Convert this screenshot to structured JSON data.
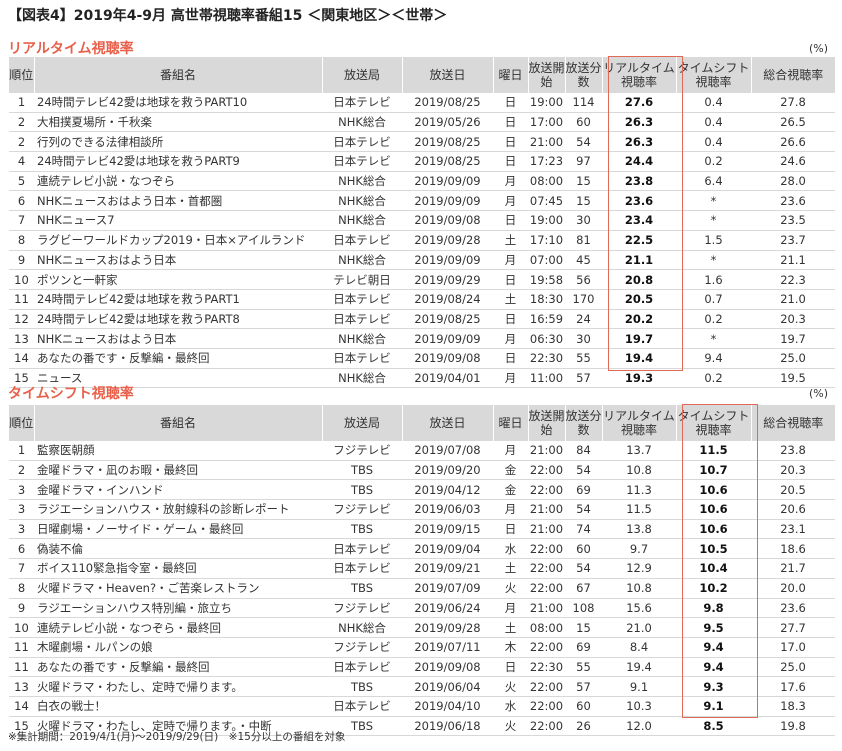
{
  "title": "【図表4】2019年4-9月 高世帯視聴率番組15 ＜関東地区＞＜世帯＞",
  "unit": "(%)",
  "headers": {
    "rank": "順位",
    "program": "番組名",
    "station": "放送局",
    "date": "放送日",
    "day": "曜日",
    "start": "放送開始",
    "minutes": "放送分数",
    "realtime": "リアルタイム視聴率",
    "timeshift": "タイムシフト視聴率",
    "total": "総合視聴率"
  },
  "realtime_section": {
    "title": "リアルタイム視聴率",
    "rows": [
      {
        "rank": "1",
        "program": "24時間テレビ42愛は地球を救うPART10",
        "station": "日本テレビ",
        "date": "2019/08/25",
        "day": "日",
        "start": "19:00",
        "minutes": "114",
        "realtime": "27.6",
        "timeshift": "0.4",
        "total": "27.8"
      },
      {
        "rank": "2",
        "program": "大相撲夏場所・千秋楽",
        "station": "NHK総合",
        "date": "2019/05/26",
        "day": "日",
        "start": "17:00",
        "minutes": "60",
        "realtime": "26.3",
        "timeshift": "0.4",
        "total": "26.5"
      },
      {
        "rank": "2",
        "program": "行列のできる法律相談所",
        "station": "日本テレビ",
        "date": "2019/08/25",
        "day": "日",
        "start": "21:00",
        "minutes": "54",
        "realtime": "26.3",
        "timeshift": "0.4",
        "total": "26.6"
      },
      {
        "rank": "4",
        "program": "24時間テレビ42愛は地球を救うPART9",
        "station": "日本テレビ",
        "date": "2019/08/25",
        "day": "日",
        "start": "17:23",
        "minutes": "97",
        "realtime": "24.4",
        "timeshift": "0.2",
        "total": "24.6"
      },
      {
        "rank": "5",
        "program": "連続テレビ小説・なつぞら",
        "station": "NHK総合",
        "date": "2019/09/09",
        "day": "月",
        "start": "08:00",
        "minutes": "15",
        "realtime": "23.8",
        "timeshift": "6.4",
        "total": "28.0"
      },
      {
        "rank": "6",
        "program": "NHKニュースおはよう日本・首都圏",
        "station": "NHK総合",
        "date": "2019/09/09",
        "day": "月",
        "start": "07:45",
        "minutes": "15",
        "realtime": "23.6",
        "timeshift": "*",
        "total": "23.6"
      },
      {
        "rank": "7",
        "program": "NHKニュース7",
        "station": "NHK総合",
        "date": "2019/09/08",
        "day": "日",
        "start": "19:00",
        "minutes": "30",
        "realtime": "23.4",
        "timeshift": "*",
        "total": "23.5"
      },
      {
        "rank": "8",
        "program": "ラグビーワールドカップ2019・日本×アイルランド",
        "station": "日本テレビ",
        "date": "2019/09/28",
        "day": "土",
        "start": "17:10",
        "minutes": "81",
        "realtime": "22.5",
        "timeshift": "1.5",
        "total": "23.7"
      },
      {
        "rank": "9",
        "program": "NHKニュースおはよう日本",
        "station": "NHK総合",
        "date": "2019/09/09",
        "day": "月",
        "start": "07:00",
        "minutes": "45",
        "realtime": "21.1",
        "timeshift": "*",
        "total": "21.1"
      },
      {
        "rank": "10",
        "program": "ポツンと一軒家",
        "station": "テレビ朝日",
        "date": "2019/09/29",
        "day": "日",
        "start": "19:58",
        "minutes": "56",
        "realtime": "20.8",
        "timeshift": "1.6",
        "total": "22.3"
      },
      {
        "rank": "11",
        "program": "24時間テレビ42愛は地球を救うPART1",
        "station": "日本テレビ",
        "date": "2019/08/24",
        "day": "土",
        "start": "18:30",
        "minutes": "170",
        "realtime": "20.5",
        "timeshift": "0.7",
        "total": "21.0"
      },
      {
        "rank": "12",
        "program": "24時間テレビ42愛は地球を救うPART8",
        "station": "日本テレビ",
        "date": "2019/08/25",
        "day": "日",
        "start": "16:59",
        "minutes": "24",
        "realtime": "20.2",
        "timeshift": "0.2",
        "total": "20.3"
      },
      {
        "rank": "13",
        "program": "NHKニュースおはよう日本",
        "station": "NHK総合",
        "date": "2019/09/09",
        "day": "月",
        "start": "06:30",
        "minutes": "30",
        "realtime": "19.7",
        "timeshift": "*",
        "total": "19.7"
      },
      {
        "rank": "14",
        "program": "あなたの番です・反撃編・最終回",
        "station": "日本テレビ",
        "date": "2019/09/08",
        "day": "日",
        "start": "22:30",
        "minutes": "55",
        "realtime": "19.4",
        "timeshift": "9.4",
        "total": "25.0"
      },
      {
        "rank": "15",
        "program": "ニュース",
        "station": "NHK総合",
        "date": "2019/04/01",
        "day": "月",
        "start": "11:00",
        "minutes": "57",
        "realtime": "19.3",
        "timeshift": "0.2",
        "total": "19.5"
      }
    ]
  },
  "timeshift_section": {
    "title": "タイムシフト視聴率",
    "rows": [
      {
        "rank": "1",
        "program": "監察医朝顔",
        "station": "フジテレビ",
        "date": "2019/07/08",
        "day": "月",
        "start": "21:00",
        "minutes": "84",
        "realtime": "13.7",
        "timeshift": "11.5",
        "total": "23.8"
      },
      {
        "rank": "2",
        "program": "金曜ドラマ・凪のお暇・最終回",
        "station": "TBS",
        "date": "2019/09/20",
        "day": "金",
        "start": "22:00",
        "minutes": "54",
        "realtime": "10.8",
        "timeshift": "10.7",
        "total": "20.3"
      },
      {
        "rank": "3",
        "program": "金曜ドラマ・インハンド",
        "station": "TBS",
        "date": "2019/04/12",
        "day": "金",
        "start": "22:00",
        "minutes": "69",
        "realtime": "11.3",
        "timeshift": "10.6",
        "total": "20.5"
      },
      {
        "rank": "3",
        "program": "ラジエーションハウス・放射線科の診断レポート",
        "station": "フジテレビ",
        "date": "2019/06/03",
        "day": "月",
        "start": "21:00",
        "minutes": "54",
        "realtime": "11.5",
        "timeshift": "10.6",
        "total": "20.6"
      },
      {
        "rank": "3",
        "program": "日曜劇場・ノーサイド・ゲーム・最終回",
        "station": "TBS",
        "date": "2019/09/15",
        "day": "日",
        "start": "21:00",
        "minutes": "74",
        "realtime": "13.8",
        "timeshift": "10.6",
        "total": "23.1"
      },
      {
        "rank": "6",
        "program": "偽装不倫",
        "station": "日本テレビ",
        "date": "2019/09/04",
        "day": "水",
        "start": "22:00",
        "minutes": "60",
        "realtime": "9.7",
        "timeshift": "10.5",
        "total": "18.6"
      },
      {
        "rank": "7",
        "program": "ボイス110緊急指令室・最終回",
        "station": "日本テレビ",
        "date": "2019/09/21",
        "day": "土",
        "start": "22:00",
        "minutes": "54",
        "realtime": "12.9",
        "timeshift": "10.4",
        "total": "21.7"
      },
      {
        "rank": "8",
        "program": "火曜ドラマ・Heaven?・ご苦楽レストラン",
        "station": "TBS",
        "date": "2019/07/09",
        "day": "火",
        "start": "22:00",
        "minutes": "67",
        "realtime": "10.8",
        "timeshift": "10.2",
        "total": "20.0"
      },
      {
        "rank": "9",
        "program": "ラジエーションハウス特別編・旅立ち",
        "station": "フジテレビ",
        "date": "2019/06/24",
        "day": "月",
        "start": "21:00",
        "minutes": "108",
        "realtime": "15.6",
        "timeshift": "9.8",
        "total": "23.6"
      },
      {
        "rank": "10",
        "program": "連続テレビ小説・なつぞら・最終回",
        "station": "NHK総合",
        "date": "2019/09/28",
        "day": "土",
        "start": "08:00",
        "minutes": "15",
        "realtime": "21.0",
        "timeshift": "9.5",
        "total": "27.7"
      },
      {
        "rank": "11",
        "program": "木曜劇場・ルパンの娘",
        "station": "フジテレビ",
        "date": "2019/07/11",
        "day": "木",
        "start": "22:00",
        "minutes": "69",
        "realtime": "8.4",
        "timeshift": "9.4",
        "total": "17.0"
      },
      {
        "rank": "11",
        "program": "あなたの番です・反撃編・最終回",
        "station": "日本テレビ",
        "date": "2019/09/08",
        "day": "日",
        "start": "22:30",
        "minutes": "55",
        "realtime": "19.4",
        "timeshift": "9.4",
        "total": "25.0"
      },
      {
        "rank": "13",
        "program": "火曜ドラマ・わたし、定時で帰ります。",
        "station": "TBS",
        "date": "2019/06/04",
        "day": "火",
        "start": "22:00",
        "minutes": "57",
        "realtime": "9.1",
        "timeshift": "9.3",
        "total": "17.6"
      },
      {
        "rank": "14",
        "program": "白衣の戦士！",
        "station": "日本テレビ",
        "date": "2019/04/10",
        "day": "水",
        "start": "22:00",
        "minutes": "60",
        "realtime": "10.3",
        "timeshift": "9.1",
        "total": "18.3"
      },
      {
        "rank": "15",
        "program": "火曜ドラマ・わたし、定時で帰ります。・中断",
        "station": "TBS",
        "date": "2019/06/18",
        "day": "火",
        "start": "22:00",
        "minutes": "26",
        "realtime": "12.0",
        "timeshift": "8.5",
        "total": "19.8"
      }
    ]
  },
  "footnote": "※集計期間：2019/4/1(月)〜2019/9/29(日)　※15分以上の番組を対象",
  "colors": {
    "accent": "#e8604a",
    "highlight_border": "#e06a55",
    "header_bg": "#d9d9d9"
  }
}
